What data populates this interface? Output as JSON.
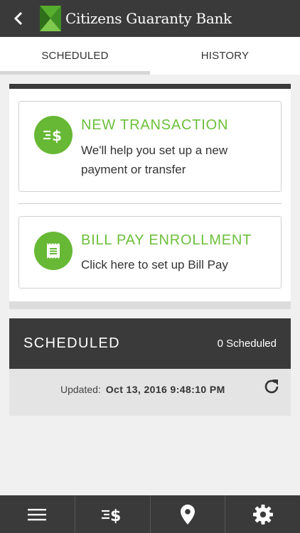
{
  "header": {
    "title": "Citizens Guaranty Bank",
    "back_icon": "chevron-left-icon",
    "logo_icon": "bank-logo-icon"
  },
  "tabs": [
    {
      "label": "SCHEDULED",
      "active": true
    },
    {
      "label": "HISTORY",
      "active": false
    }
  ],
  "actions": {
    "new_transaction": {
      "title": "NEW TRANSACTION",
      "description": "We'll help you set up a new payment or transfer",
      "icon": "transfer-dollar-icon"
    },
    "bill_pay": {
      "title": "BILL PAY ENROLLMENT",
      "description": "Click here to set up Bill Pay",
      "icon": "receipt-icon"
    }
  },
  "scheduled": {
    "title": "SCHEDULED",
    "count_label": "0 Scheduled",
    "updated_label": "Updated:",
    "updated_value": "Oct 13, 2016 9:48:10 PM",
    "refresh_icon": "refresh-icon"
  },
  "bottom_nav": [
    {
      "icon": "menu-icon"
    },
    {
      "icon": "transfer-dollar-icon"
    },
    {
      "icon": "location-pin-icon"
    },
    {
      "icon": "gear-icon"
    }
  ],
  "colors": {
    "dark": "#3a3a3a",
    "accent_green": "#67b834",
    "title_green": "#6cbf3a",
    "background": "#f0f0f0"
  }
}
